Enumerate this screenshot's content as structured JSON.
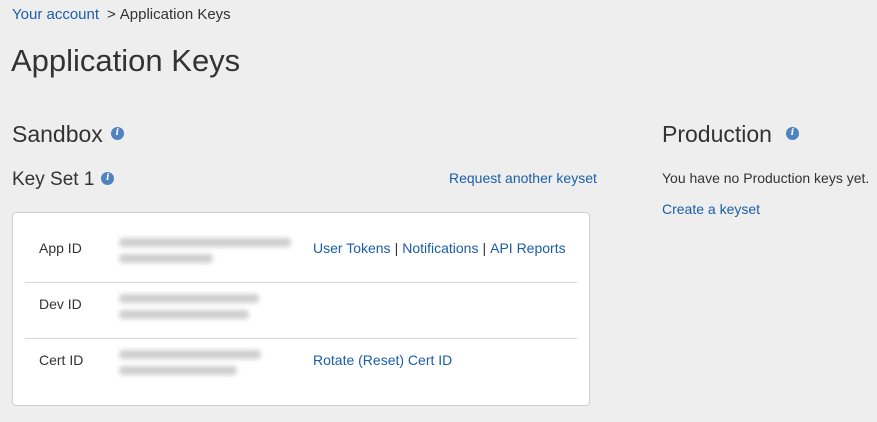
{
  "breadcrumb": {
    "account_link": "Your account",
    "separator": ">",
    "current": "Application Keys"
  },
  "page_title": "Application Keys",
  "sandbox": {
    "title": "Sandbox",
    "info_icon": "info-icon",
    "keyset": {
      "title": "Key Set 1",
      "request_link": "Request another keyset",
      "rows": [
        {
          "label": "App ID",
          "value_hidden": true,
          "actions": [
            {
              "label": "User Tokens"
            },
            {
              "label": "Notifications"
            },
            {
              "label": "API Reports"
            }
          ]
        },
        {
          "label": "Dev ID",
          "value_hidden": true,
          "actions": []
        },
        {
          "label": "Cert ID",
          "value_hidden": true,
          "actions": [
            {
              "label": "Rotate (Reset) Cert ID"
            }
          ]
        }
      ]
    }
  },
  "production": {
    "title": "Production",
    "info_icon": "info-icon",
    "empty_message": "You have no Production keys yet.",
    "create_link": "Create a keyset"
  },
  "colors": {
    "link": "#1a5ea8",
    "background": "#efeeee",
    "info_icon": "#4f82c0",
    "card_border": "#cfcfcf"
  }
}
